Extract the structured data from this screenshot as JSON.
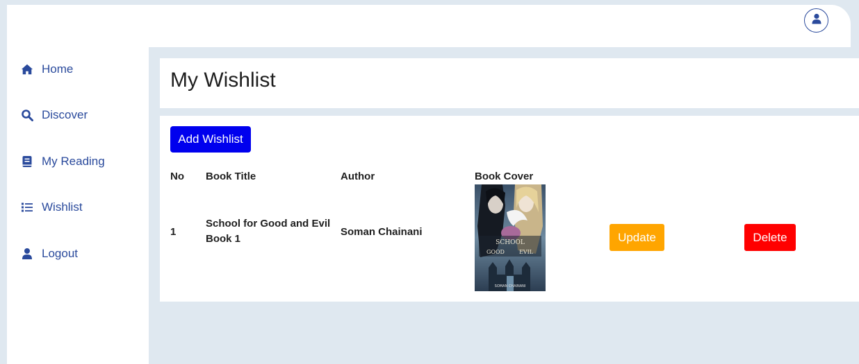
{
  "colors": {
    "page_bg": "#dfe8f0",
    "nav_text": "#2a4a9c",
    "add_button": "#0000ee",
    "update_button": "#ffa500",
    "delete_button": "#ff0000"
  },
  "topbar": {
    "profile_icon": "user-circle-icon"
  },
  "sidebar": {
    "items": [
      {
        "label": "Home",
        "icon": "home-icon"
      },
      {
        "label": "Discover",
        "icon": "search-icon"
      },
      {
        "label": "My Reading",
        "icon": "book-icon"
      },
      {
        "label": "Wishlist",
        "icon": "list-icon"
      },
      {
        "label": "Logout",
        "icon": "user-icon"
      }
    ]
  },
  "main": {
    "title": "My Wishlist",
    "add_button_label": "Add Wishlist",
    "table": {
      "columns": [
        "No",
        "Book Title",
        "Author",
        "Book Cover"
      ],
      "rows": [
        {
          "no": "1",
          "title_line1": "School for Good and Evil",
          "title_line2": "Book 1",
          "author": "Soman Chainani",
          "cover": {
            "title_word1": "SCHOOL",
            "title_word2": "GOOD",
            "title_word3": "EVIL",
            "author": "SOMAN CHAINANI"
          },
          "update_label": "Update",
          "delete_label": "Delete"
        }
      ]
    }
  }
}
